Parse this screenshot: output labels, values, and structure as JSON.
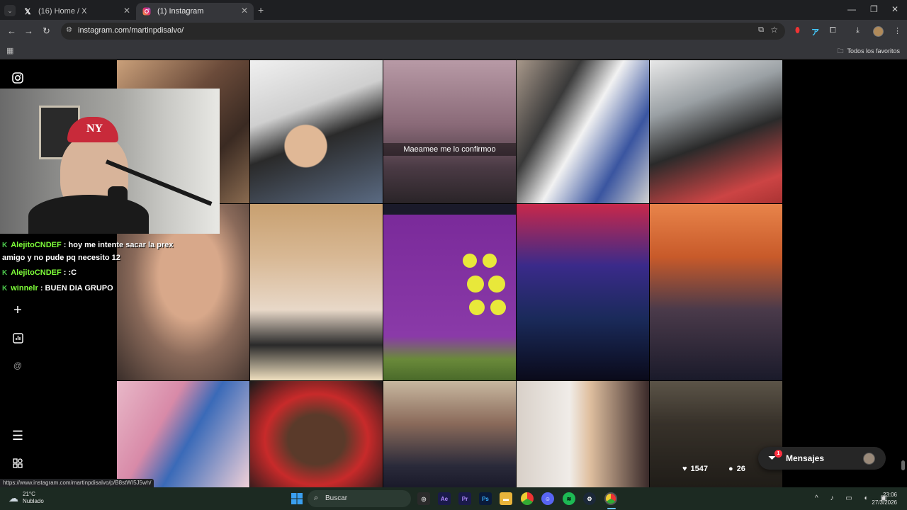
{
  "browser": {
    "tabs": [
      {
        "title": "(16) Home / X",
        "icon": "x-logo-icon"
      },
      {
        "title": "(1) Instagram",
        "icon": "instagram-icon"
      }
    ],
    "new_tab": "+",
    "url": "instagram.com/martinpdisalvo/",
    "bookmark_folder": "Todos los favoritos"
  },
  "instagram": {
    "sidebar_icons": [
      "instagram-logo-icon",
      "create-icon",
      "insights-icon",
      "threads-icon",
      "menu-icon",
      "more-apps-icon"
    ],
    "tile_caption": "Maeamee me lo confirmoo",
    "hover_stats": {
      "likes": "1547",
      "comments": "26"
    },
    "messages": {
      "label": "Mensajes",
      "badge": "1"
    },
    "status_url": "https://www.instagram.com/martinpdisalvo/p/B8stWI5J5wh/"
  },
  "stream_chat": [
    {
      "user": "AlejitoCNDEF",
      "text": ": hoy me intente sacar la prex"
    },
    {
      "user": "",
      "text": "amigo y no pude pq necesito 12"
    },
    {
      "user": "AlejitoCNDEF",
      "text": ": :C"
    },
    {
      "user": "winnelr",
      "text": ": BUEN DIA GRUPO"
    }
  ],
  "taskbar": {
    "weather_temp": "21°C",
    "weather_desc": "Nublado",
    "search_placeholder": "Buscar",
    "time": "23:06",
    "date": "27/3/2026",
    "apps": [
      "Ae",
      "Pr",
      "Ps"
    ]
  },
  "colors": {
    "chrome_dark": "#1e1f22",
    "chrome_toolbar": "#35363a",
    "chat_username": "#7fff3a",
    "taskbar": "#1c2a22"
  }
}
